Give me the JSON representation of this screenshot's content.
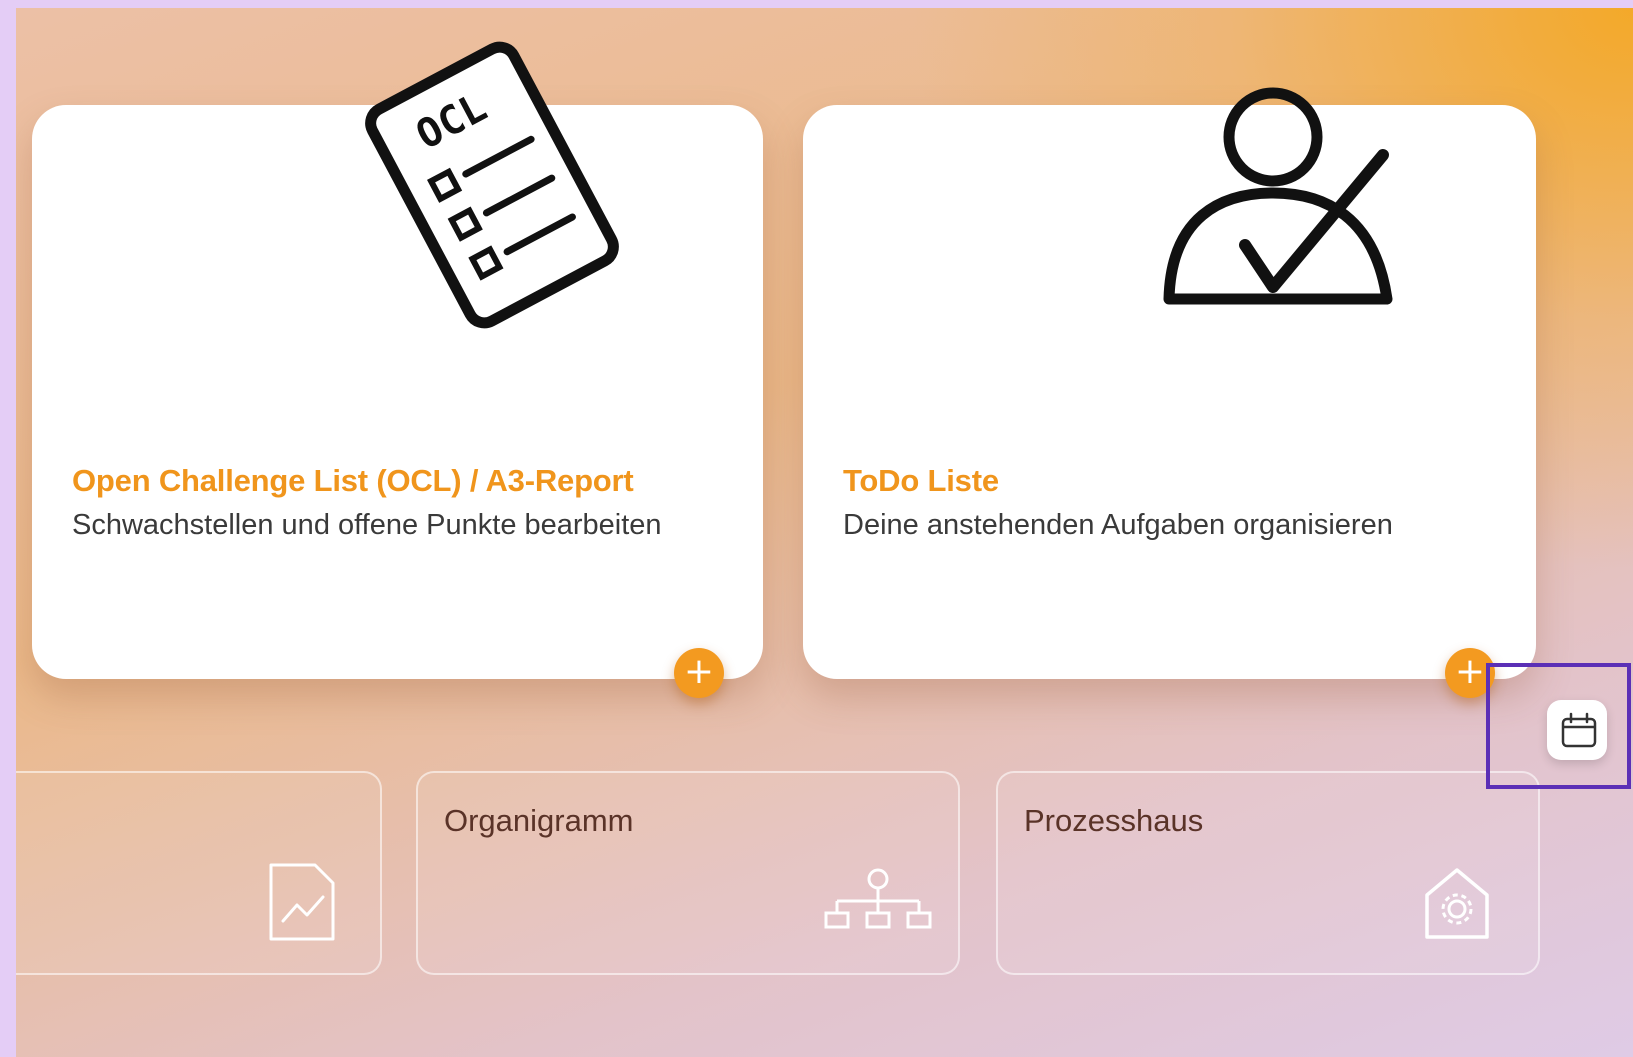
{
  "cards": [
    {
      "title": "Open Challenge List (OCL) / A3-Report",
      "description": "Schwachstellen und offene Punkte bearbeiten",
      "illustration_text": "OCL",
      "icon": "checklist-illustration",
      "add_label": "+"
    },
    {
      "title": "ToDo Liste",
      "description": "Deine anstehenden Aufgaben organisieren",
      "icon": "person-check-illustration",
      "add_label": "+"
    }
  ],
  "tiles": [
    {
      "label": "",
      "icon": "chart-document-icon"
    },
    {
      "label": "Organigramm",
      "icon": "org-chart-icon"
    },
    {
      "label": "Prozesshaus",
      "icon": "process-house-icon"
    }
  ],
  "side_button": {
    "icon": "calendar-icon"
  },
  "colors": {
    "accent": "#f39a20",
    "title": "#f0951c",
    "highlight_border": "#5b2fb6",
    "tile_label": "#5a3328"
  }
}
